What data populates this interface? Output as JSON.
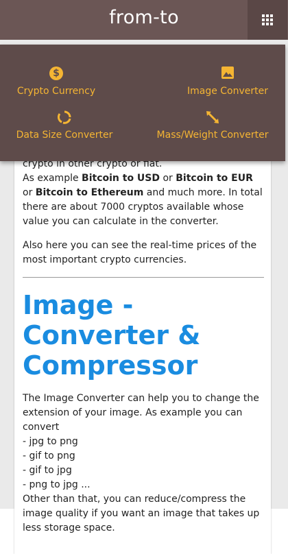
{
  "header": {
    "brand": "from-to",
    "menu_icon": "grid-icon"
  },
  "menu": {
    "items": [
      {
        "label": "Crypto Currency",
        "icon": "dollar-icon"
      },
      {
        "label": "Image Converter",
        "icon": "image-icon"
      },
      {
        "label": "Data Size Converter",
        "icon": "cycle-icon"
      },
      {
        "label": "Mass/Weight Converter",
        "icon": "resize-icon"
      }
    ],
    "icon_color": "#f5b533",
    "bg_color": "#5e4b4a"
  },
  "content": {
    "crypto_tail": "crypto in other crypto or fiat.",
    "example_prefix": "As example ",
    "ex1": "Bitcoin to USD",
    "or1": " or ",
    "ex2": "Bitcoin to EUR",
    "or2": " or ",
    "ex3": "Bitcoin to Ethereum",
    "ex_suffix": " and much more. In total there are about 7000 cryptos available whose value you can calculate in the converter.",
    "realtime": "Also here you can see the real-time prices of the most important crypto currencies.",
    "image_heading_bold": "Image",
    "image_heading_rest": " - Converter & Compressor",
    "image_intro": "The Image Converter can help you to change the extension of your image. As example you can convert",
    "conversions": [
      "- jpg to png",
      "- gif to png",
      "- gif to jpg",
      "- png to jpg ..."
    ],
    "compress": "Other than that, you can reduce/compress the image quality if you want an image that takes up less storage space."
  }
}
